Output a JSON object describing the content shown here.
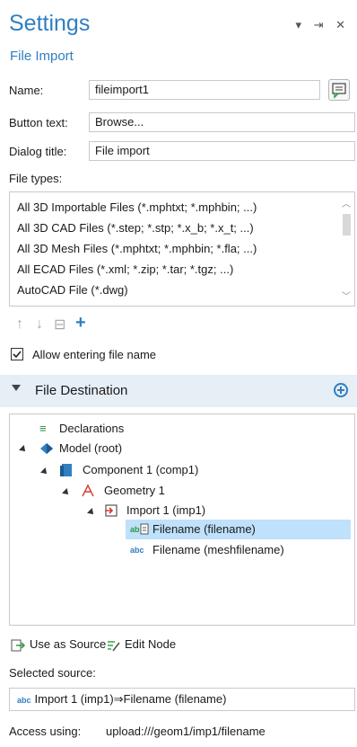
{
  "header": {
    "title": "Settings",
    "subtitle": "File Import",
    "window_controls": "▾ ⇥ ✕"
  },
  "form": {
    "name_label": "Name:",
    "name_value": "fileimport1",
    "button_text_label": "Button text:",
    "button_text_value": "Browse...",
    "dialog_title_label": "Dialog title:",
    "dialog_title_value": "File import",
    "file_types_label": "File types:"
  },
  "file_types": [
    "All 3D Importable Files (*.mphtxt; *.mphbin; ...)",
    "All 3D CAD Files (*.step; *.stp; *.x_b; *.x_t; ...)",
    "All 3D Mesh Files (*.mphtxt; *.mphbin; *.fla; ...)",
    "All ECAD Files (*.xml; *.zip; *.tar; *.tgz; ...)",
    "AutoCAD File (*.dwg)"
  ],
  "list_toolbar": {
    "up": "↑",
    "down": "↓",
    "clear": "⊟",
    "add": "+"
  },
  "allow_entering": {
    "label": "Allow entering file name",
    "checked": true
  },
  "section": {
    "label": "File Destination"
  },
  "tree": {
    "declarations": "Declarations",
    "model": "Model (root)",
    "component": "Component 1 (comp1)",
    "geometry": "Geometry 1",
    "import": "Import 1 (imp1)",
    "filename": "Filename (filename)",
    "meshfilename": "Filename (meshfilename)",
    "abc": "abc",
    "ab": "ab"
  },
  "actions": {
    "use_as_source": "Use as Source",
    "edit_node": "Edit Node"
  },
  "selected_source": {
    "label": "Selected source:",
    "value": "Import 1 (imp1)⇒Filename (filename)"
  },
  "access": {
    "label": "Access using:",
    "value": "upload:///geom1/imp1/filename"
  }
}
